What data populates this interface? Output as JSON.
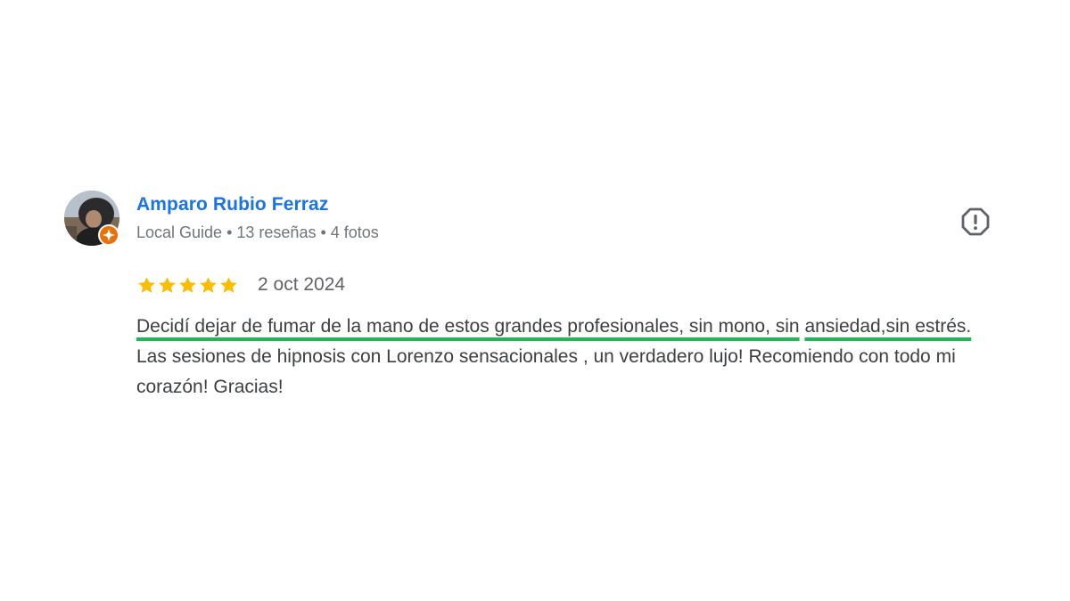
{
  "review": {
    "author": {
      "name": "Amparo Rubio Ferraz",
      "badge": "Local Guide",
      "separator": "•",
      "reviews_count": "13 reseñas",
      "photos_count": "4 fotos",
      "avatar_icon": "user-photo-avatar",
      "badge_icon": "local-guide-star-icon"
    },
    "rating": 5,
    "rating_max": 5,
    "date": "2 oct 2024",
    "text_highlighted_line1": "Decidí dejar de fumar de la mano de estos grandes profesionales, sin mono, sin",
    "text_highlighted_line2": "ansiedad,sin estrés.",
    "text_rest": " Las sesiones de hipnosis con Lorenzo sensacionales , un verdadero lujo! Recomiendo con todo mi corazón! Gracias!",
    "report_icon": "report-exclamation-icon"
  },
  "colors": {
    "name": "#1a73e8",
    "meta": "#70757a",
    "text": "#3c4043",
    "star": "#fbbc04",
    "highlight_underline": "#1db954",
    "badge": "#e8710a"
  }
}
